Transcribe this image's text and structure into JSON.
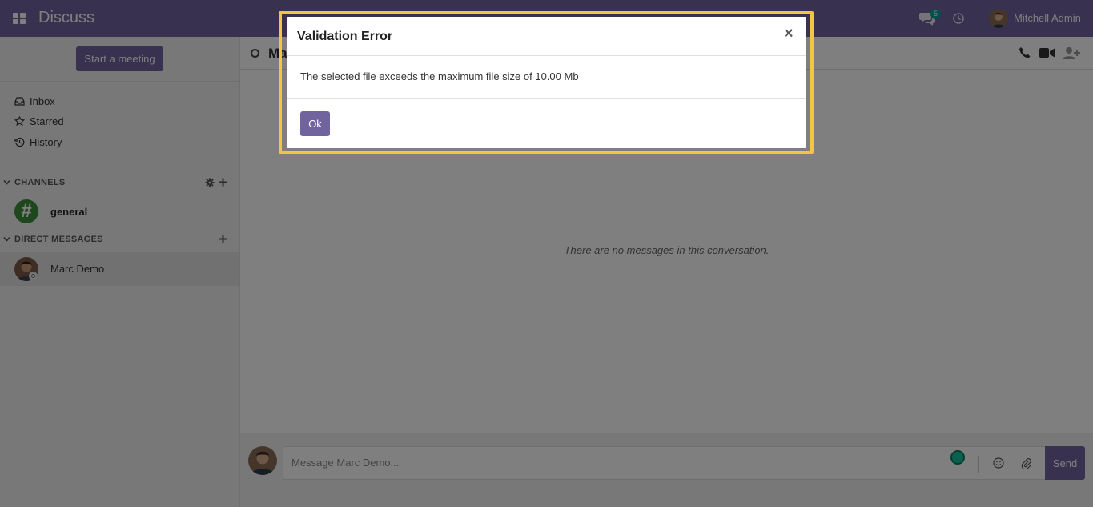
{
  "navbar": {
    "app_title": "Discuss",
    "chat_badge": "5",
    "user_name": "Mitchell Admin",
    "brand_color": "#71639e"
  },
  "sidebar": {
    "start_meeting_label": "Start a meeting",
    "mailboxes": [
      {
        "label": "Inbox",
        "icon": "inbox-icon"
      },
      {
        "label": "Starred",
        "icon": "star-icon"
      },
      {
        "label": "History",
        "icon": "history-icon"
      }
    ],
    "channels": {
      "title": "CHANNELS",
      "items": [
        {
          "name": "general",
          "avatar_glyph": "#"
        }
      ]
    },
    "direct_messages": {
      "title": "DIRECT MESSAGES",
      "items": [
        {
          "name": "Marc Demo"
        }
      ]
    }
  },
  "thread": {
    "title": "Marc Demo",
    "empty_message": "There are no messages in this conversation.",
    "composer_placeholder": "Message Marc Demo...",
    "send_label": "Send"
  },
  "dialog": {
    "title": "Validation Error",
    "close_glyph": "×",
    "message": "The selected file exceeds the maximum file size of 10.00 Mb",
    "ok_label": "Ok",
    "highlight_color": "#f4c542"
  }
}
